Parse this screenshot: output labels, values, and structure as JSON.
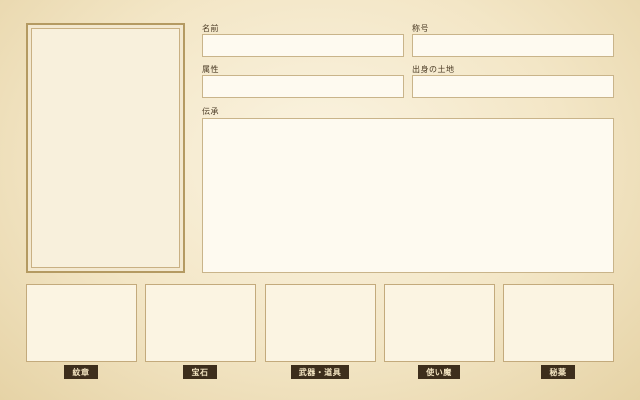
{
  "fields": {
    "name_label": "名前",
    "title_label": "称号",
    "attribute_label": "属性",
    "origin_label": "出身の土地",
    "legend_label": "伝承"
  },
  "slots": [
    {
      "label": "紋章"
    },
    {
      "label": "宝石"
    },
    {
      "label": "武器・道具"
    },
    {
      "label": "使い魔"
    },
    {
      "label": "秘薬"
    }
  ]
}
